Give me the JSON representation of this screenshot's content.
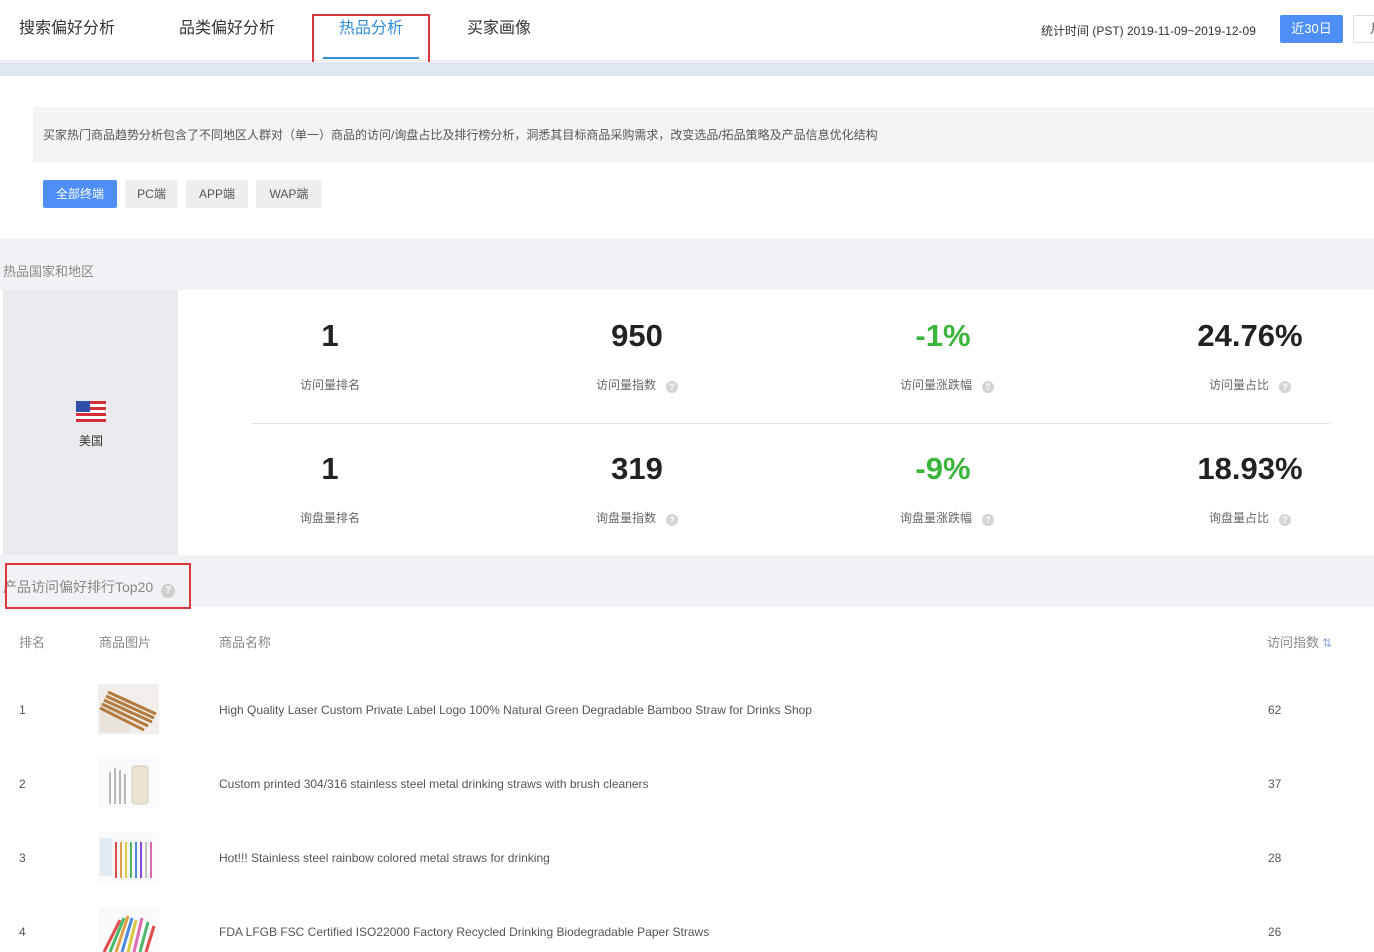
{
  "tabs": [
    {
      "label": "搜索偏好分析"
    },
    {
      "label": "品类偏好分析"
    },
    {
      "label": "热品分析"
    },
    {
      "label": "买家画像"
    }
  ],
  "stat_time": "统计时间 (PST) 2019-11-09~2019-12-09",
  "range_buttons": {
    "last30": "近30日",
    "month": "月"
  },
  "description": "买家热门商品趋势分析包含了不同地区人群对（单一）商品的访问/询盘占比及排行榜分析，洞悉其目标商品采购需求，改变选品/拓品策略及产品信息优化结构",
  "filters": [
    {
      "label": "全部终端"
    },
    {
      "label": "PC端"
    },
    {
      "label": "APP端"
    },
    {
      "label": "WAP端"
    }
  ],
  "hot_section": {
    "title": "热品国家和地区",
    "country": "美国",
    "visits": [
      {
        "value": "1",
        "label": "访问量排名"
      },
      {
        "value": "950",
        "label": "访问量指数"
      },
      {
        "value": "-1%",
        "label": "访问量涨跌幅"
      },
      {
        "value": "24.76%",
        "label": "访问量占比"
      }
    ],
    "inquiries": [
      {
        "value": "1",
        "label": "询盘量排名"
      },
      {
        "value": "319",
        "label": "询盘量指数"
      },
      {
        "value": "-9%",
        "label": "询盘量涨跌幅"
      },
      {
        "value": "18.93%",
        "label": "询盘量占比"
      }
    ]
  },
  "top20": {
    "title": "产品访问偏好排行Top20",
    "columns": {
      "rank": "排名",
      "image": "商品图片",
      "name": "商品名称",
      "index": "访问指数"
    },
    "rows": [
      {
        "rank": "1",
        "image": "bamboo-straw-thumbnail",
        "name": "High Quality Laser Custom Private Label Logo 100% Natural Green Degradable Bamboo Straw for Drinks Shop",
        "index": "62"
      },
      {
        "rank": "2",
        "image": "steel-straw-thumbnail",
        "name": "Custom printed 304/316 stainless steel metal drinking straws with brush cleaners",
        "index": "37"
      },
      {
        "rank": "3",
        "image": "rainbow-straw-thumbnail",
        "name": "Hot!!! Stainless steel rainbow colored metal straws for drinking",
        "index": "28"
      },
      {
        "rank": "4",
        "image": "paper-straw-thumbnail",
        "name": "FDA LFGB FSC Certified ISO22000 Factory Recycled Drinking Biodegradable Paper Straws",
        "index": "26"
      }
    ]
  },
  "colors": {
    "accent": "#4d8ff5",
    "tab_active": "#2f8cde",
    "positive_change": "#3cb53c",
    "highlight_box": "#d9363e"
  }
}
